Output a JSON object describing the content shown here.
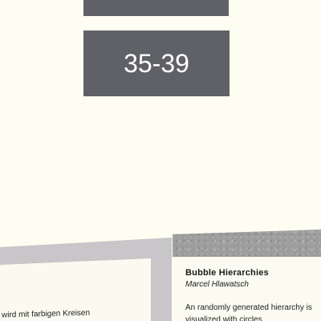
{
  "tiles": {
    "top_label": "",
    "main_label": "35-39"
  },
  "cards": {
    "left": {
      "snippet": "wird mit farbigen Kreisen"
    },
    "right": {
      "title": "Bubble Hierarchies",
      "author": "Marcel Hlawatsch",
      "description": "An randomly generated hierarchy is visualized with circles"
    }
  }
}
